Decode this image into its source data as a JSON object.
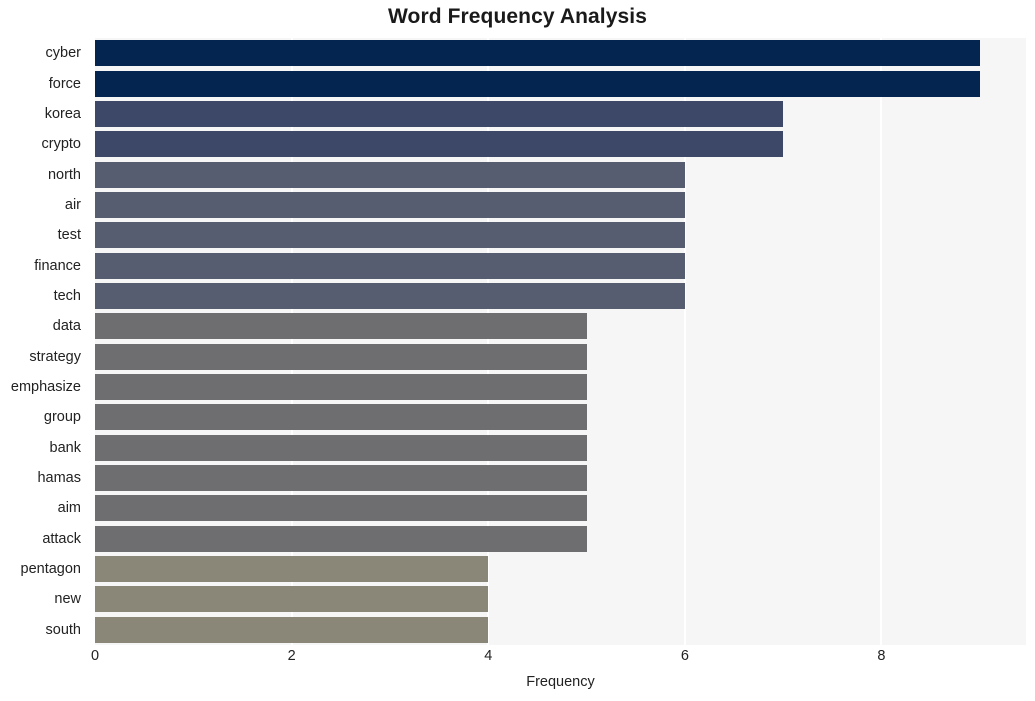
{
  "chart_data": {
    "type": "bar",
    "orientation": "horizontal",
    "title": "Word Frequency Analysis",
    "xlabel": "Frequency",
    "ylabel": "",
    "categories": [
      "cyber",
      "force",
      "korea",
      "crypto",
      "north",
      "air",
      "test",
      "finance",
      "tech",
      "data",
      "strategy",
      "emphasize",
      "group",
      "bank",
      "hamas",
      "aim",
      "attack",
      "pentagon",
      "new",
      "south"
    ],
    "values": [
      9,
      9,
      7,
      7,
      6,
      6,
      6,
      6,
      6,
      5,
      5,
      5,
      5,
      5,
      5,
      5,
      5,
      4,
      4,
      4
    ],
    "bar_colors": [
      "#042550",
      "#042550",
      "#3d4768",
      "#3d4768",
      "#575d71",
      "#575d71",
      "#575d71",
      "#575d71",
      "#575d71",
      "#6e6e70",
      "#6e6e70",
      "#6e6e70",
      "#6e6e70",
      "#6e6e70",
      "#6e6e70",
      "#6e6e70",
      "#6e6e70",
      "#8a8678",
      "#8a8678",
      "#8a8678"
    ],
    "xlim": [
      0,
      9.47
    ],
    "xticks": [
      0,
      2,
      4,
      6,
      8
    ],
    "xtick_labels": [
      "0",
      "2",
      "4",
      "6",
      "8"
    ],
    "gridlines": true,
    "gridline_color": "#ffffff",
    "plot_background": "#f6f6f7",
    "figure_background": "#ffffff",
    "legend": null
  }
}
